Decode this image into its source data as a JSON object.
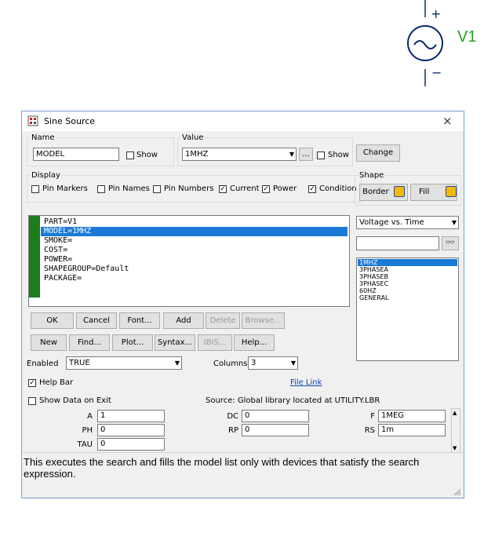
{
  "symbol": {
    "label": "V1"
  },
  "window": {
    "title": "Sine Source",
    "close": "×"
  },
  "name_group": {
    "legend": "Name",
    "value": "MODEL",
    "show_label": "Show"
  },
  "value_group": {
    "legend": "Value",
    "value": "1MHZ",
    "browse": "...",
    "show_label": "Show",
    "change": "Change"
  },
  "display_group": {
    "legend": "Display",
    "options": [
      {
        "label": "Pin Markers",
        "checked": false
      },
      {
        "label": "Pin Names",
        "checked": false
      },
      {
        "label": "Pin Numbers",
        "checked": false
      },
      {
        "label": "Current",
        "checked": true
      },
      {
        "label": "Power",
        "checked": true
      },
      {
        "label": "Condition",
        "checked": true
      }
    ]
  },
  "shape_group": {
    "legend": "Shape",
    "border": "Border",
    "fill": "Fill"
  },
  "attributes": [
    "PART=V1",
    "MODEL=1MHZ",
    "SMOKE=",
    "COST=",
    "POWER=",
    "SHAPEGROUP=Default",
    "PACKAGE="
  ],
  "selected_attribute_index": 1,
  "plot_combo": {
    "value": "Voltage vs. Time"
  },
  "search": {
    "value": ""
  },
  "models": [
    "1MHZ",
    "3PHASEA",
    "3PHASEB",
    "3PHASEC",
    "60HZ",
    "GENERAL"
  ],
  "selected_model_index": 0,
  "buttons_row1": {
    "ok": "OK",
    "cancel": "Cancel",
    "font": "Font...",
    "add": "Add",
    "delete": "Delete",
    "browse": "Browse..."
  },
  "buttons_row2": {
    "new": "New",
    "find": "Find...",
    "plot": "Plot...",
    "syntax": "Syntax...",
    "ibis": "IBIS...",
    "help": "Help..."
  },
  "enabled": {
    "label": "Enabled",
    "value": "TRUE"
  },
  "columns": {
    "label": "Columns",
    "value": "3"
  },
  "help_bar": {
    "label": "Help Bar",
    "checked": true
  },
  "file_link": "File Link",
  "show_data": {
    "label": "Show Data on Exit",
    "checked": false
  },
  "source_text": "Source: Global library located at UTILITY.LBR",
  "params": {
    "A": "1",
    "PH": "0",
    "TAU": "0",
    "DC": "0",
    "RP": "0",
    "F": "1MEG",
    "RS": "1m"
  },
  "param_labels": {
    "A": "A",
    "PH": "PH",
    "TAU": "TAU",
    "DC": "DC",
    "RP": "RP",
    "F": "F",
    "RS": "RS"
  },
  "status_text": "This executes the search and fills the model list only with devices that satisfy the search expression."
}
